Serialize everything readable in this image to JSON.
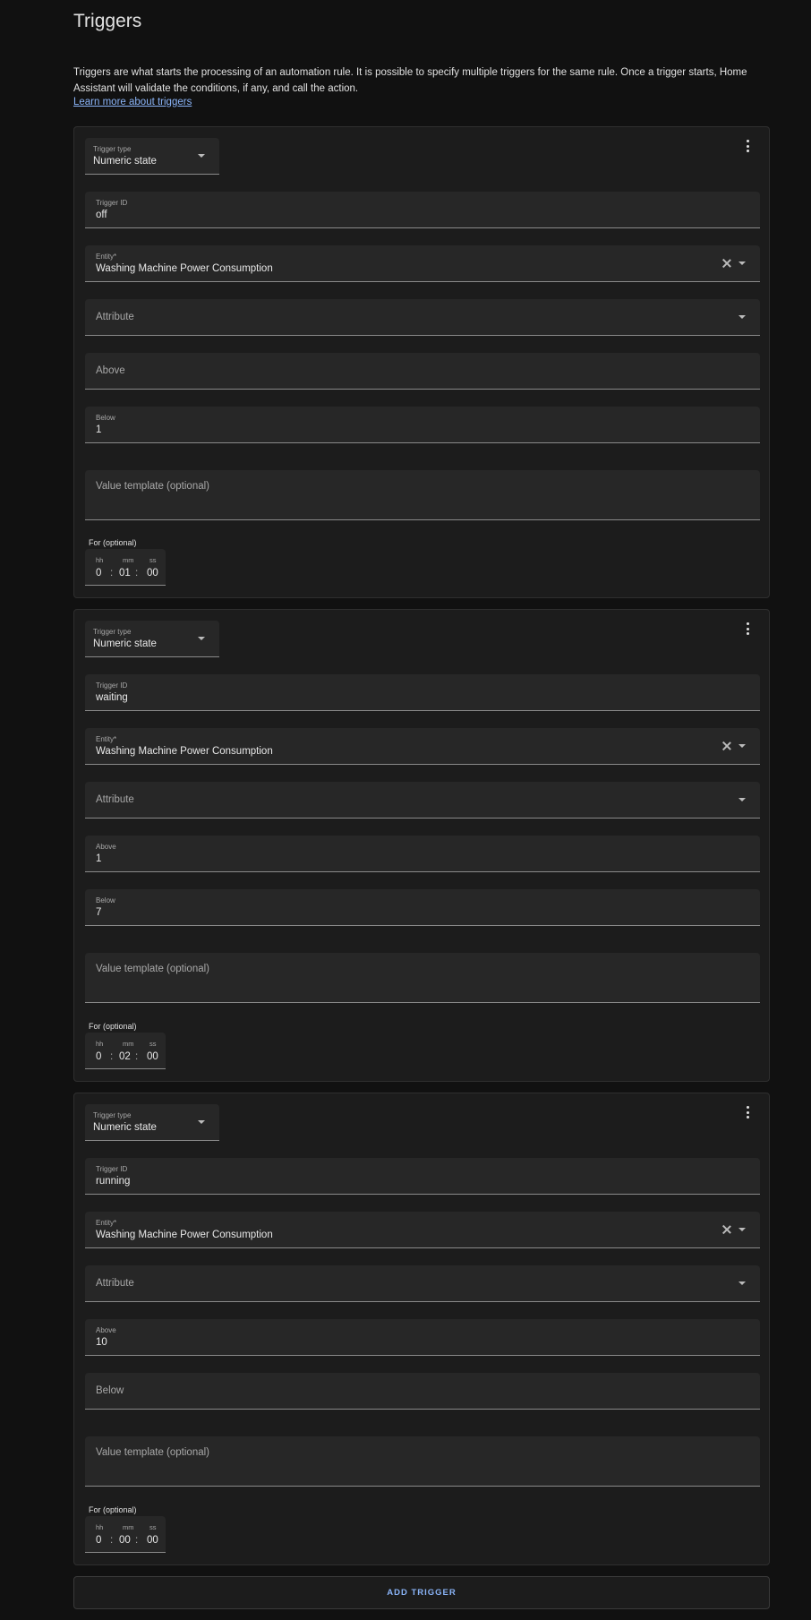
{
  "section": {
    "title": "Triggers",
    "description": "Triggers are what starts the processing of an automation rule. It is possible to specify multiple triggers for the same rule. Once a trigger starts, Home Assistant will validate the conditions, if any, and call the action.",
    "learn_more": "Learn more about triggers"
  },
  "labels": {
    "trigger_type": "Trigger type",
    "trigger_id": "Trigger ID",
    "entity": "Entity*",
    "attribute": "Attribute",
    "above": "Above",
    "below": "Below",
    "value_template": "Value template (optional)",
    "for": "For (optional)",
    "hh": "hh",
    "mm": "mm",
    "ss": "ss",
    "separator": ":"
  },
  "triggers": [
    {
      "type": "Numeric state",
      "id": "off",
      "entity": "Washing Machine Power Consumption",
      "above": "",
      "below": "1",
      "for": {
        "hh": "0",
        "mm": "01",
        "ss": "00"
      }
    },
    {
      "type": "Numeric state",
      "id": "waiting",
      "entity": "Washing Machine Power Consumption",
      "above": "1",
      "below": "7",
      "for": {
        "hh": "0",
        "mm": "02",
        "ss": "00"
      }
    },
    {
      "type": "Numeric state",
      "id": "running",
      "entity": "Washing Machine Power Consumption",
      "above": "10",
      "below": "",
      "for": {
        "hh": "0",
        "mm": "00",
        "ss": "00"
      }
    }
  ],
  "add_button": "ADD TRIGGER"
}
